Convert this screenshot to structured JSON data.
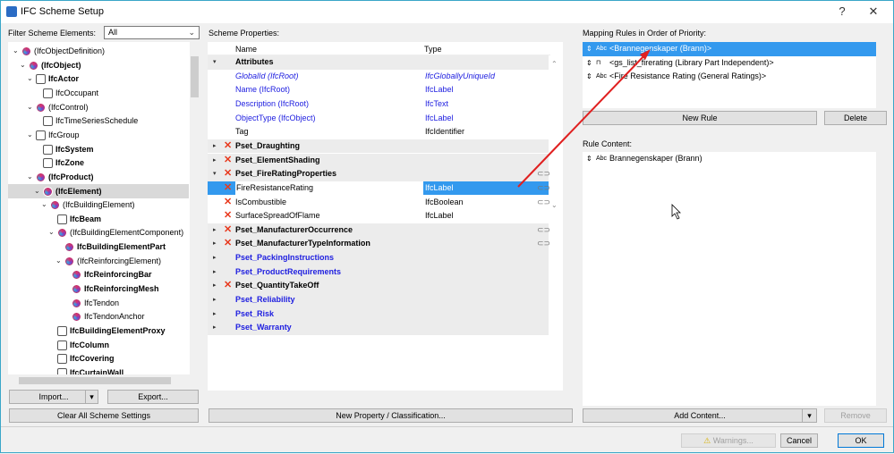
{
  "window": {
    "title": "IFC Scheme Setup",
    "help": "?",
    "close": "✕"
  },
  "left": {
    "filter_label": "Filter Scheme Elements:",
    "filter_value": "All",
    "tree": [
      {
        "label": "(IfcObjectDefinition)",
        "level": 0,
        "exp": true,
        "bold": false,
        "icon": "ifc"
      },
      {
        "label": "(IfcObject)",
        "level": 1,
        "exp": true,
        "bold": true,
        "icon": "ifc"
      },
      {
        "label": "IfcActor",
        "level": 2,
        "exp": true,
        "bold": true,
        "icon": "actor"
      },
      {
        "label": "IfcOccupant",
        "level": 3,
        "exp": false,
        "bold": false,
        "icon": "actor"
      },
      {
        "label": "(IfcControl)",
        "level": 2,
        "exp": true,
        "bold": false,
        "icon": "ifc"
      },
      {
        "label": "IfcTimeSeriesSchedule",
        "level": 3,
        "exp": false,
        "bold": false,
        "icon": "schedule"
      },
      {
        "label": "IfcGroup",
        "level": 2,
        "exp": true,
        "bold": false,
        "icon": "group"
      },
      {
        "label": "IfcSystem",
        "level": 3,
        "exp": false,
        "bold": true,
        "icon": "system"
      },
      {
        "label": "IfcZone",
        "level": 3,
        "exp": false,
        "bold": true,
        "icon": "zone"
      },
      {
        "label": "(IfcProduct)",
        "level": 2,
        "exp": true,
        "bold": true,
        "icon": "ifc"
      },
      {
        "label": "(IfcElement)",
        "level": 3,
        "exp": true,
        "bold": true,
        "icon": "ifc",
        "selected": true
      },
      {
        "label": "(IfcBuildingElement)",
        "level": 4,
        "exp": true,
        "bold": false,
        "icon": "ifc"
      },
      {
        "label": "IfcBeam",
        "level": 5,
        "exp": false,
        "bold": true,
        "icon": "beam"
      },
      {
        "label": "(IfcBuildingElementComponent)",
        "level": 5,
        "exp": true,
        "bold": false,
        "icon": "ifc"
      },
      {
        "label": "IfcBuildingElementPart",
        "level": 6,
        "exp": false,
        "bold": true,
        "icon": "ifc"
      },
      {
        "label": "(IfcReinforcingElement)",
        "level": 6,
        "exp": true,
        "bold": false,
        "icon": "ifc"
      },
      {
        "label": "IfcReinforcingBar",
        "level": 7,
        "exp": false,
        "bold": true,
        "icon": "ifc"
      },
      {
        "label": "IfcReinforcingMesh",
        "level": 7,
        "exp": false,
        "bold": true,
        "icon": "ifc"
      },
      {
        "label": "IfcTendon",
        "level": 7,
        "exp": false,
        "bold": false,
        "icon": "ifc"
      },
      {
        "label": "IfcTendonAnchor",
        "level": 7,
        "exp": false,
        "bold": false,
        "icon": "ifc"
      },
      {
        "label": "IfcBuildingElementProxy",
        "level": 5,
        "exp": false,
        "bold": true,
        "icon": "proxy"
      },
      {
        "label": "IfcColumn",
        "level": 5,
        "exp": false,
        "bold": true,
        "icon": "column"
      },
      {
        "label": "IfcCovering",
        "level": 5,
        "exp": false,
        "bold": true,
        "icon": "covering"
      },
      {
        "label": "IfcCurtainWall",
        "level": 5,
        "exp": false,
        "bold": true,
        "icon": "curtainwall"
      }
    ],
    "import_label": "Import...",
    "export_label": "Export...",
    "clear_label": "Clear All Scheme Settings"
  },
  "middle": {
    "label": "Scheme Properties:",
    "col_name": "Name",
    "col_type": "Type",
    "rows": [
      {
        "name": "Attributes",
        "type": "",
        "kind": "group",
        "exp": true,
        "x": false,
        "color": "black",
        "link": false
      },
      {
        "name": "GlobalId (IfcRoot)",
        "type": "IfcGloballyUniqueId",
        "kind": "item",
        "x": false,
        "color": "blue",
        "italic": true,
        "link": false
      },
      {
        "name": "Name (IfcRoot)",
        "type": "IfcLabel",
        "kind": "item",
        "x": false,
        "color": "blue",
        "link": false
      },
      {
        "name": "Description (IfcRoot)",
        "type": "IfcText",
        "kind": "item",
        "x": false,
        "color": "blue",
        "link": false
      },
      {
        "name": "ObjectType (IfcObject)",
        "type": "IfcLabel",
        "kind": "item",
        "x": false,
        "color": "blue",
        "link": false
      },
      {
        "name": "Tag",
        "type": "IfcIdentifier",
        "kind": "item",
        "x": false,
        "color": "black",
        "link": false
      },
      {
        "name": "Pset_Draughting",
        "type": "",
        "kind": "group",
        "exp": false,
        "x": true,
        "color": "black",
        "link": false
      },
      {
        "name": "Pset_ElementShading",
        "type": "",
        "kind": "group",
        "exp": false,
        "x": true,
        "color": "black",
        "link": false
      },
      {
        "name": "Pset_FireRatingProperties",
        "type": "",
        "kind": "group",
        "exp": true,
        "x": true,
        "color": "black",
        "link": true
      },
      {
        "name": "FireResistanceRating",
        "type": "IfcLabel",
        "kind": "item",
        "x": true,
        "color": "black",
        "link": true,
        "selected": true
      },
      {
        "name": "IsCombustible",
        "type": "IfcBoolean",
        "kind": "item",
        "x": true,
        "color": "black",
        "link": true
      },
      {
        "name": "SurfaceSpreadOfFlame",
        "type": "IfcLabel",
        "kind": "item",
        "x": true,
        "color": "black",
        "link": false
      },
      {
        "name": "Pset_ManufacturerOccurrence",
        "type": "",
        "kind": "group",
        "exp": false,
        "x": true,
        "color": "black",
        "link": true
      },
      {
        "name": "Pset_ManufacturerTypeInformation",
        "type": "",
        "kind": "group",
        "exp": false,
        "x": true,
        "color": "black",
        "link": true
      },
      {
        "name": "Pset_PackingInstructions",
        "type": "",
        "kind": "group",
        "exp": false,
        "x": false,
        "color": "blue",
        "link": false
      },
      {
        "name": "Pset_ProductRequirements",
        "type": "",
        "kind": "group",
        "exp": false,
        "x": false,
        "color": "blue",
        "link": false
      },
      {
        "name": "Pset_QuantityTakeOff",
        "type": "",
        "kind": "group",
        "exp": false,
        "x": true,
        "color": "black",
        "link": false
      },
      {
        "name": "Pset_Reliability",
        "type": "",
        "kind": "group",
        "exp": false,
        "x": false,
        "color": "blue",
        "link": false
      },
      {
        "name": "Pset_Risk",
        "type": "",
        "kind": "group",
        "exp": false,
        "x": false,
        "color": "blue",
        "link": false
      },
      {
        "name": "Pset_Warranty",
        "type": "",
        "kind": "group",
        "exp": false,
        "x": false,
        "color": "blue",
        "link": false
      }
    ],
    "new_property_label": "New Property / Classification..."
  },
  "right": {
    "mapping_label": "Mapping Rules in Order of Priority:",
    "rules": [
      {
        "label": "<Brannegenskaper (Brann)>",
        "icon": "Abc",
        "selected": true
      },
      {
        "label": "<gs_list_firerating (Library Part Independent)>",
        "icon": "library-part"
      },
      {
        "label": "<Fire Resistance Rating (General Ratings)>",
        "icon": "Abc"
      }
    ],
    "new_rule_label": "New Rule",
    "delete_label": "Delete",
    "content_label": "Rule Content:",
    "content": [
      {
        "label": "Brannegenskaper (Brann)",
        "icon": "Abc"
      }
    ],
    "add_content_label": "Add Content...",
    "remove_label": "Remove"
  },
  "footer": {
    "warnings_label": "Warnings...",
    "cancel_label": "Cancel",
    "ok_label": "OK"
  },
  "colors": {
    "selection": "#3399ee",
    "accent_border": "#3aa6c8",
    "annotation_arrow": "#e02020",
    "delete_x": "#e8381c",
    "inherited_text": "#2020e0"
  }
}
